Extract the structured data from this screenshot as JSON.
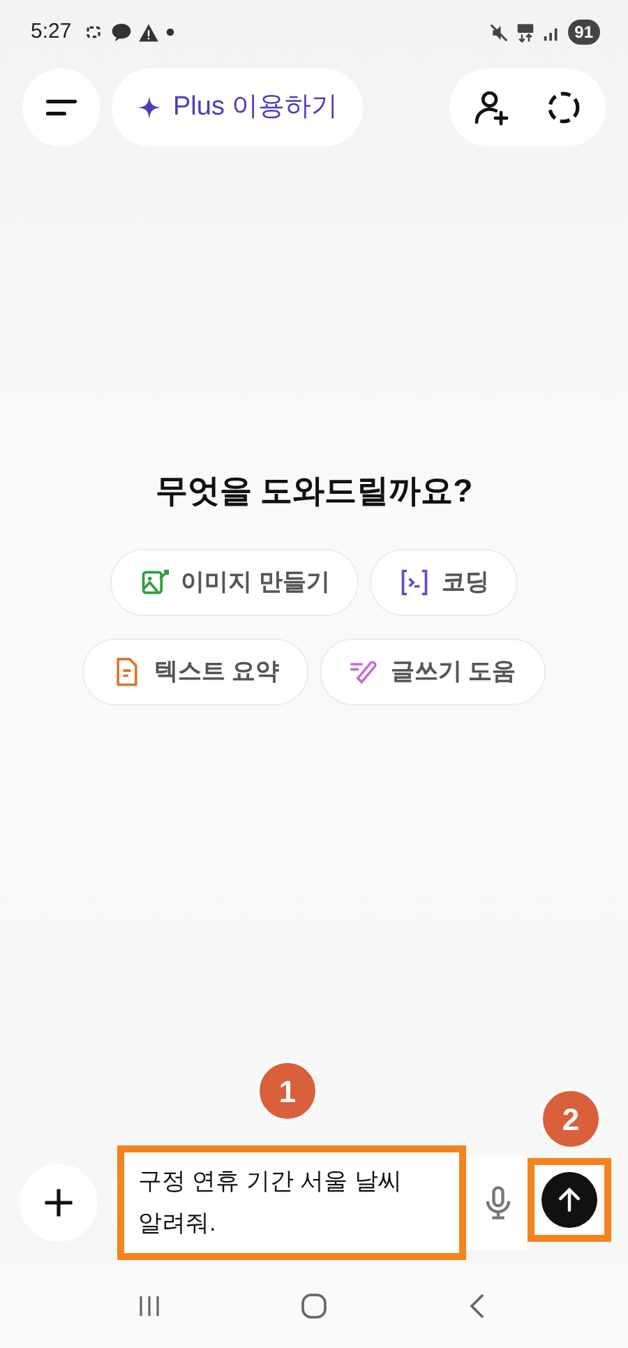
{
  "status_bar": {
    "time": "5:27",
    "battery": "91"
  },
  "header": {
    "upgrade_button": {
      "label": "Plus 이용하기"
    }
  },
  "greeting": "무엇을 도와드릴까요?",
  "suggestions": [
    {
      "kind": "image",
      "label": "이미지 만들기",
      "color": "#2e9e3e"
    },
    {
      "kind": "code",
      "label": "코딩",
      "color": "#5a50c8"
    },
    {
      "kind": "summary",
      "label": "텍스트 요약",
      "color": "#d9772e"
    },
    {
      "kind": "writing",
      "label": "글쓰기 도움",
      "color": "#c46fd0"
    }
  ],
  "composer": {
    "text": "구정 연휴 기간 서울 날씨 알려줘.",
    "highlighted": true,
    "send_highlighted": true
  },
  "annotations": [
    {
      "label": "1"
    },
    {
      "label": "2"
    }
  ]
}
